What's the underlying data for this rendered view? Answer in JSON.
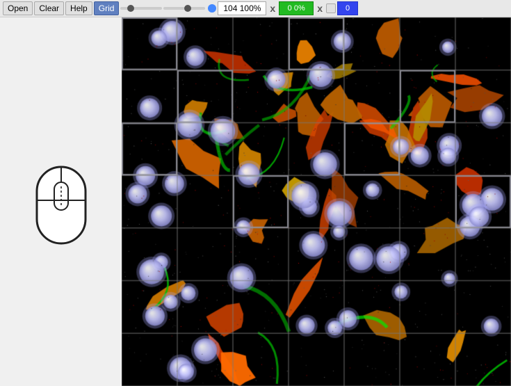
{
  "toolbar": {
    "open_label": "Open",
    "clear_label": "Clear",
    "help_label": "Help",
    "grid_label": "Grid",
    "zoom_value": "104",
    "zoom_percent": "100%",
    "green_value": "0",
    "green_percent": "0%",
    "blue_value": "0",
    "close_x": "x",
    "close_x2": "x"
  },
  "mouse": {
    "icon_label": "mouse-icon"
  }
}
